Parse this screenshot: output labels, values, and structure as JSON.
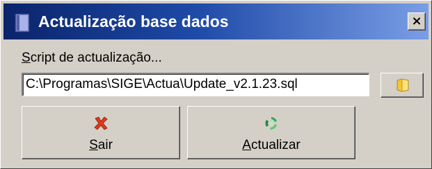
{
  "window": {
    "title": "Actualização base dados",
    "close_label": "×"
  },
  "form": {
    "script_label_first": "S",
    "script_label_rest": "cript de actualização...",
    "script_path": "C:\\Programas\\SIGE\\Actua\\Update_v2.1.23.sql"
  },
  "buttons": {
    "exit": {
      "label_first": "S",
      "label_rest": "air",
      "icon": "red-x-icon"
    },
    "update": {
      "label_first": "A",
      "label_rest": "ctualizar",
      "icon": "green-recycle-icon"
    },
    "browse": {
      "icon": "folder-icon"
    }
  },
  "colors": {
    "titlebar_start": "#0a246a",
    "titlebar_end": "#7a9ee6",
    "face": "#d4d0c8"
  }
}
